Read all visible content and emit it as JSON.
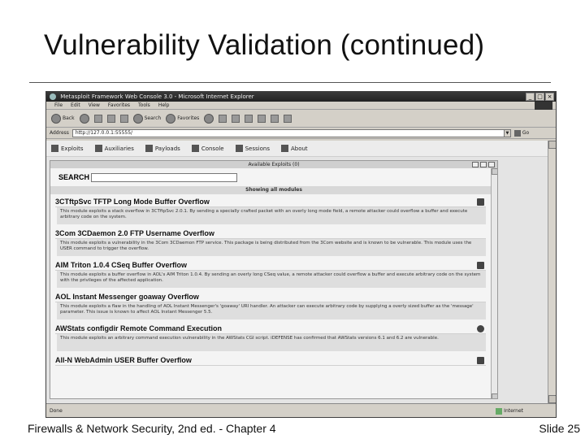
{
  "slide": {
    "title": "Vulnerability Validation (continued)",
    "footer_left": "Firewalls & Network Security, 2nd ed. - Chapter 4",
    "footer_right": "Slide 25"
  },
  "browser": {
    "window_title": "Metasploit Framework Web Console 3.0 - Microsoft Internet Explorer",
    "menu": [
      "File",
      "Edit",
      "View",
      "Favorites",
      "Tools",
      "Help"
    ],
    "toolbar": {
      "back": "Back",
      "search": "Search",
      "favorites": "Favorites"
    },
    "address_label": "Address",
    "address_value": "http://127.0.0.1:55555/",
    "go_label": "Go",
    "status_text": "Done",
    "status_zone": "Internet"
  },
  "app": {
    "nav": [
      "Exploits",
      "Auxiliaries",
      "Payloads",
      "Console",
      "Sessions",
      "About"
    ],
    "window_title": "Available Exploits (0)",
    "search_label": "SEARCH",
    "search_value": "",
    "showing_text": "Showing all modules",
    "modules": [
      {
        "name": "3CTftpSvc TFTP Long Mode Buffer Overflow",
        "description": "This module exploits a stack overflow in 3CTftpSvc 2.0.1. By sending a specially crafted packet with an overly long mode field, a remote attacker could overflow a buffer and execute arbitrary code on the system."
      },
      {
        "name": "3Com 3CDaemon 2.0 FTP Username Overflow",
        "description": "This module exploits a vulnerability in the 3Com 3CDaemon FTP service. This package is being distributed from the 3Com website and is known to be vulnerable. This module uses the USER command to trigger the overflow."
      },
      {
        "name": "AIM Triton 1.0.4 CSeq Buffer Overflow",
        "description": "This module exploits a buffer overflow in AOL's AIM Triton 1.0.4. By sending an overly long CSeq value, a remote attacker could overflow a buffer and execute arbitrary code on the system with the privileges of the affected application."
      },
      {
        "name": "AOL Instant Messenger goaway Overflow",
        "description": "This module exploits a flaw in the handling of AOL Instant Messenger's 'goaway' URI handler. An attacker can execute arbitrary code by supplying a overly sized buffer as the 'message' parameter. This issue is known to affect AOL Instant Messenger 5.5."
      },
      {
        "name": "AWStats configdir Remote Command Execution",
        "description": "This module exploits an arbitrary command execution vulnerability in the AWStats CGI script. iDEFENSE has confirmed that AWStats versions 6.1 and 6.2 are vulnerable."
      },
      {
        "name": "All-N WebAdmin USER Buffer Overflow",
        "description": ""
      }
    ]
  }
}
